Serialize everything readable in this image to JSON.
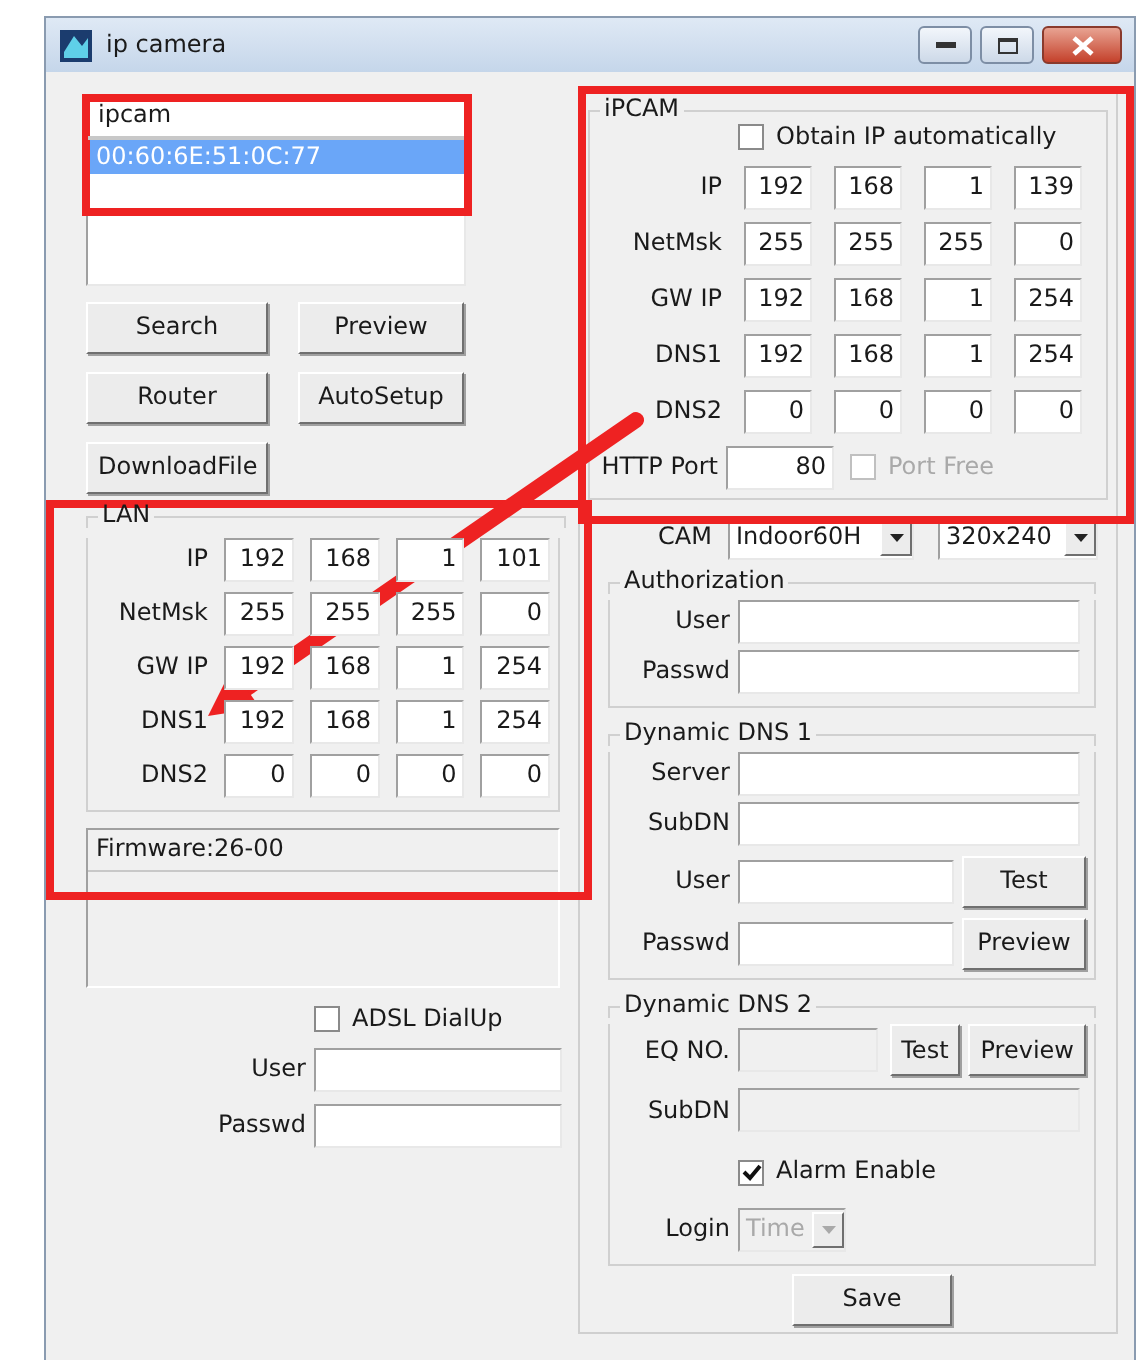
{
  "window": {
    "title": "ip camera"
  },
  "device_list": {
    "header": "ipcam",
    "items": [
      {
        "label": "00:60:6E:51:0C:77",
        "selected": true
      }
    ]
  },
  "buttons": [
    {
      "label": "Search"
    },
    {
      "label": "Preview"
    },
    {
      "label": "Router"
    },
    {
      "label": "AutoSetup"
    },
    {
      "label": "DownloadFile"
    }
  ],
  "lan": {
    "title": "LAN",
    "rows": [
      {
        "label": "IP",
        "values": [
          "192",
          "168",
          "1",
          "101"
        ]
      },
      {
        "label": "NetMsk",
        "values": [
          "255",
          "255",
          "255",
          "0"
        ]
      },
      {
        "label": "GW IP",
        "values": [
          "192",
          "168",
          "1",
          "254"
        ]
      },
      {
        "label": "DNS1",
        "values": [
          "192",
          "168",
          "1",
          "254"
        ]
      },
      {
        "label": "DNS2",
        "values": [
          "0",
          "0",
          "0",
          "0"
        ]
      }
    ]
  },
  "firmware": "Firmware:26-00",
  "adsl": {
    "label": "ADSL DialUp",
    "checked": false,
    "fields": [
      {
        "label": "User"
      },
      {
        "label": "Passwd"
      }
    ]
  },
  "ipcam": {
    "title": "iPCAM",
    "obtain_ip": {
      "label": "Obtain IP automatically",
      "checked": false
    },
    "rows": [
      {
        "label": "IP",
        "values": [
          "192",
          "168",
          "1",
          "139"
        ]
      },
      {
        "label": "NetMsk",
        "values": [
          "255",
          "255",
          "255",
          "0"
        ]
      },
      {
        "label": "GW IP",
        "values": [
          "192",
          "168",
          "1",
          "254"
        ]
      },
      {
        "label": "DNS1",
        "values": [
          "192",
          "168",
          "1",
          "254"
        ]
      },
      {
        "label": "DNS2",
        "values": [
          "0",
          "0",
          "0",
          "0"
        ]
      }
    ],
    "http_port": {
      "label": "HTTP Port",
      "value": "80"
    },
    "port_free": {
      "label": "Port Free",
      "checked": false,
      "disabled": true
    }
  },
  "cam": {
    "label": "CAM",
    "model": "Indoor60H",
    "resolution": "320x240"
  },
  "authorization": {
    "title": "Authorization",
    "fields": [
      {
        "label": "User"
      },
      {
        "label": "Passwd"
      }
    ]
  },
  "ddns1": {
    "title": "Dynamic DNS 1",
    "fields": [
      {
        "label": "Server"
      },
      {
        "label": "SubDN"
      },
      {
        "label": "User",
        "button": "Test"
      },
      {
        "label": "Passwd",
        "button": "Preview"
      }
    ]
  },
  "ddns2": {
    "title": "Dynamic DNS 2",
    "eq_no": {
      "label": "EQ NO.",
      "disabled": true
    },
    "buttons": [
      "Test",
      "Preview"
    ],
    "subdn": {
      "label": "SubDN",
      "disabled": true
    },
    "alarm": {
      "label": "Alarm Enable",
      "checked": true
    },
    "login": {
      "label": "Login",
      "value": "Time",
      "disabled": true
    }
  },
  "save": "Save"
}
